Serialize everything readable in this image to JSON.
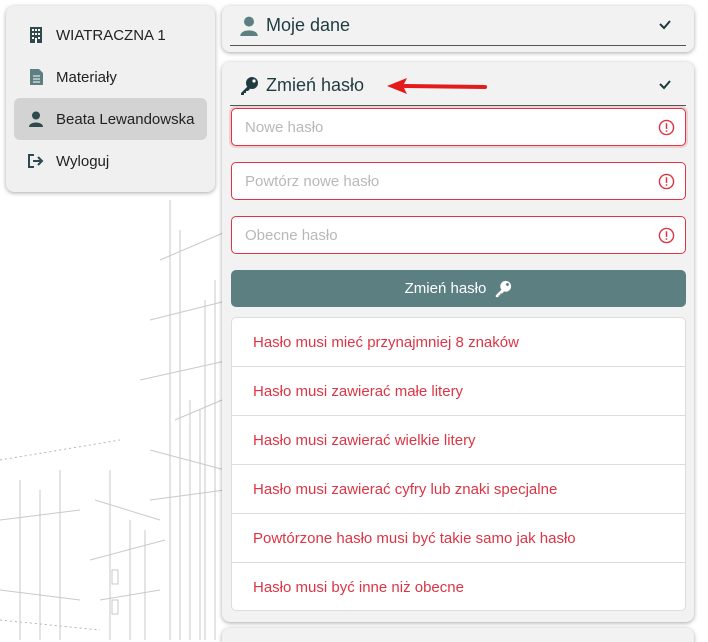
{
  "nav": {
    "items": [
      {
        "label": "WIATRACZNA 1",
        "icon": "building-icon"
      },
      {
        "label": "Materiały",
        "icon": "document-icon"
      },
      {
        "label": "Beata Lewandowska",
        "icon": "user-icon",
        "active": true
      },
      {
        "label": "Wyloguj",
        "icon": "logout-icon"
      }
    ]
  },
  "panels": {
    "my_data": {
      "title": "Moje dane",
      "icon": "user-icon"
    },
    "change_password": {
      "title": "Zmień hasło",
      "icon": "key-icon"
    }
  },
  "form": {
    "new_password": {
      "placeholder": "Nowe hasło",
      "value": ""
    },
    "repeat_password": {
      "placeholder": "Powtórz nowe hasło",
      "value": ""
    },
    "current_password": {
      "placeholder": "Obecne hasło",
      "value": ""
    },
    "submit_label": "Zmień hasło"
  },
  "validation": [
    "Hasło musi mieć przynajmniej 8 znaków",
    "Hasło musi zawierać małe litery",
    "Hasło musi zawierać wielkie litery",
    "Hasło musi zawierać cyfry lub znaki specjalne",
    "Powtórzone hasło musi być takie samo jak hasło",
    "Hasło musi być inne niż obecne"
  ],
  "colors": {
    "accent": "#5c7f82",
    "error": "#dc3545",
    "header_text": "#1f3b40",
    "arrow": "#e31b1b"
  }
}
